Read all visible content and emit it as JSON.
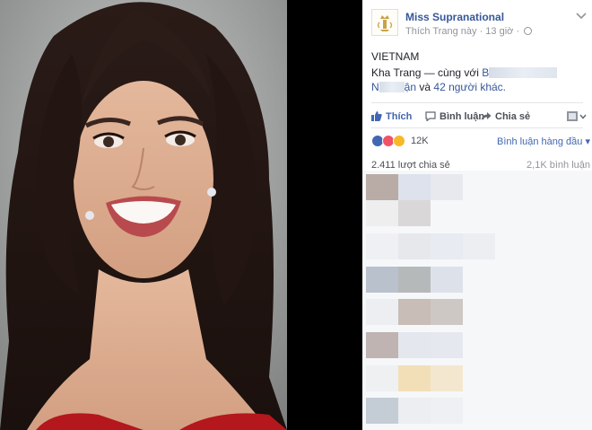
{
  "post": {
    "page_name": "Miss Supranational",
    "like_page_label": "Thích Trang này",
    "time_ago": "13 giờ",
    "meta_separator": "·",
    "caption_line1": "VIETNAM",
    "author_name": "Kha Trang",
    "with_text": "— cùng với",
    "tag_start": "B",
    "tag_n": "N",
    "tag_end": "ận",
    "and_text": "và",
    "others_link": "42 người khác."
  },
  "actions": {
    "like_label": "Thích",
    "comment_label": "Bình luận",
    "share_label": "Chia sẻ"
  },
  "reactions": {
    "count": "12K",
    "sort_label": "Bình luận hàng đầu",
    "colors": {
      "like": "#4267b2",
      "love": "#f25268",
      "haha": "#f7b928"
    }
  },
  "stats": {
    "shares": "2.411 lượt chia sẻ",
    "comments": "2,1K bình luận"
  },
  "colors": {
    "link": "#365899",
    "accent": "#4267b2",
    "text": "#1d2129",
    "muted": "#90949c"
  }
}
